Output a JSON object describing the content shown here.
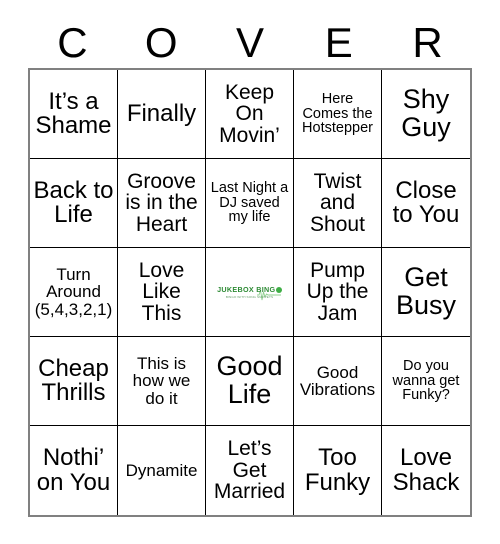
{
  "card": {
    "header_letters": [
      "C",
      "O",
      "V",
      "E",
      "R"
    ],
    "rows": [
      [
        {
          "text": "It’s a Shame",
          "size": "lg"
        },
        {
          "text": "Finally",
          "size": "lg"
        },
        {
          "text": "Keep On Movin’",
          "size": "md"
        },
        {
          "text": "Here Comes the Hotstepper",
          "size": "xs"
        },
        {
          "text": "Shy Guy",
          "size": "xl"
        }
      ],
      [
        {
          "text": "Back to Life",
          "size": "lg"
        },
        {
          "text": "Groove is in the Heart",
          "size": "md"
        },
        {
          "text": "Last Night a DJ saved my life",
          "size": "xs"
        },
        {
          "text": "Twist and Shout",
          "size": "md"
        },
        {
          "text": "Close to You",
          "size": "lg"
        }
      ],
      [
        {
          "text": "Turn Around (5,4,3,2,1)",
          "size": "sm"
        },
        {
          "text": "Love Like This",
          "size": "md"
        },
        {
          "text": "",
          "size": "md",
          "free_space": true
        },
        {
          "text": "Pump Up the Jam",
          "size": "md"
        },
        {
          "text": "Get Busy",
          "size": "xl"
        }
      ],
      [
        {
          "text": "Cheap Thrills",
          "size": "lg"
        },
        {
          "text": "This is how we do it",
          "size": "sm"
        },
        {
          "text": "Good Life",
          "size": "xl"
        },
        {
          "text": "Good Vibrations",
          "size": "sm"
        },
        {
          "text": "Do you wanna get Funky?",
          "size": "xs"
        }
      ],
      [
        {
          "text": "Nothi’ on You",
          "size": "lg"
        },
        {
          "text": "Dynamite",
          "size": "sm"
        },
        {
          "text": "Let’s Get Married",
          "size": "md"
        },
        {
          "text": "Too Funky",
          "size": "lg"
        },
        {
          "text": "Love Shack",
          "size": "lg"
        }
      ]
    ],
    "free_space_logo": {
      "main_text_before_o": "JUKEBOX BING",
      "main_text_after_o": "",
      "tagline": "BINGO WITH SONG SNIPPETS",
      "brand_color": "#2e8b35",
      "accent_color": "#3fae46"
    },
    "colors": {
      "cell_border": "#000000",
      "outer_border": "#808080",
      "text": "#000000",
      "background": "#ffffff"
    }
  }
}
